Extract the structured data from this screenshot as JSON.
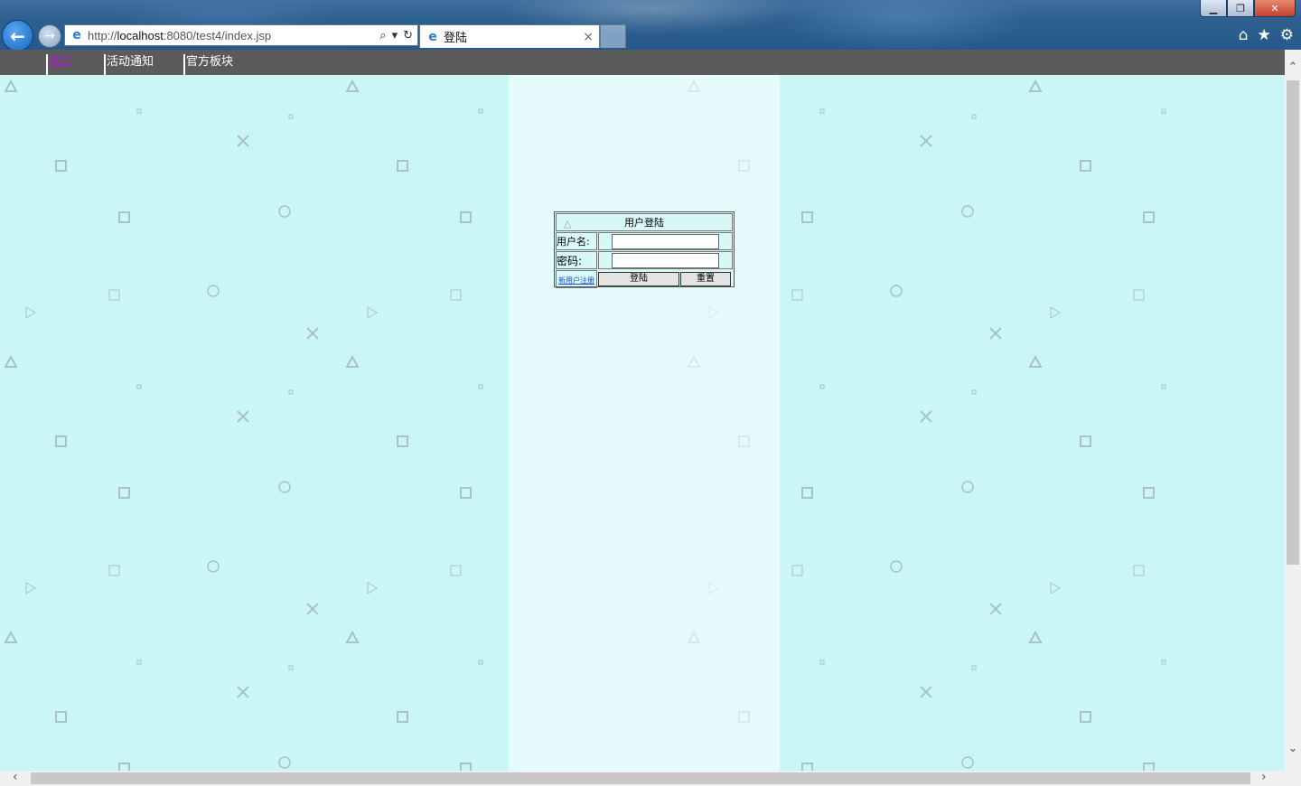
{
  "browser": {
    "address_url_prefix": "http://",
    "address_url_host": "localhost",
    "address_url_rest": ":8080/test4/index.jsp",
    "tab_title": "登陆",
    "tab_close": "×"
  },
  "menu": {
    "items": [
      {
        "label": "首页",
        "active": true
      },
      {
        "label": "活动通知",
        "active": false
      },
      {
        "label": "官方板块",
        "active": false
      }
    ]
  },
  "login": {
    "title": "用户登陆",
    "username_label": "用户名:",
    "password_label": "密码:",
    "register_link": "新用户注册",
    "login_button": "登陆",
    "reset_button": "重置",
    "username_value": "",
    "password_value": ""
  },
  "colors": {
    "page_bg": "#cbf6f6",
    "center_bg": "#e6fbfb",
    "menubar_bg": "#5b5b5b",
    "active_menu": "#a020c0"
  }
}
